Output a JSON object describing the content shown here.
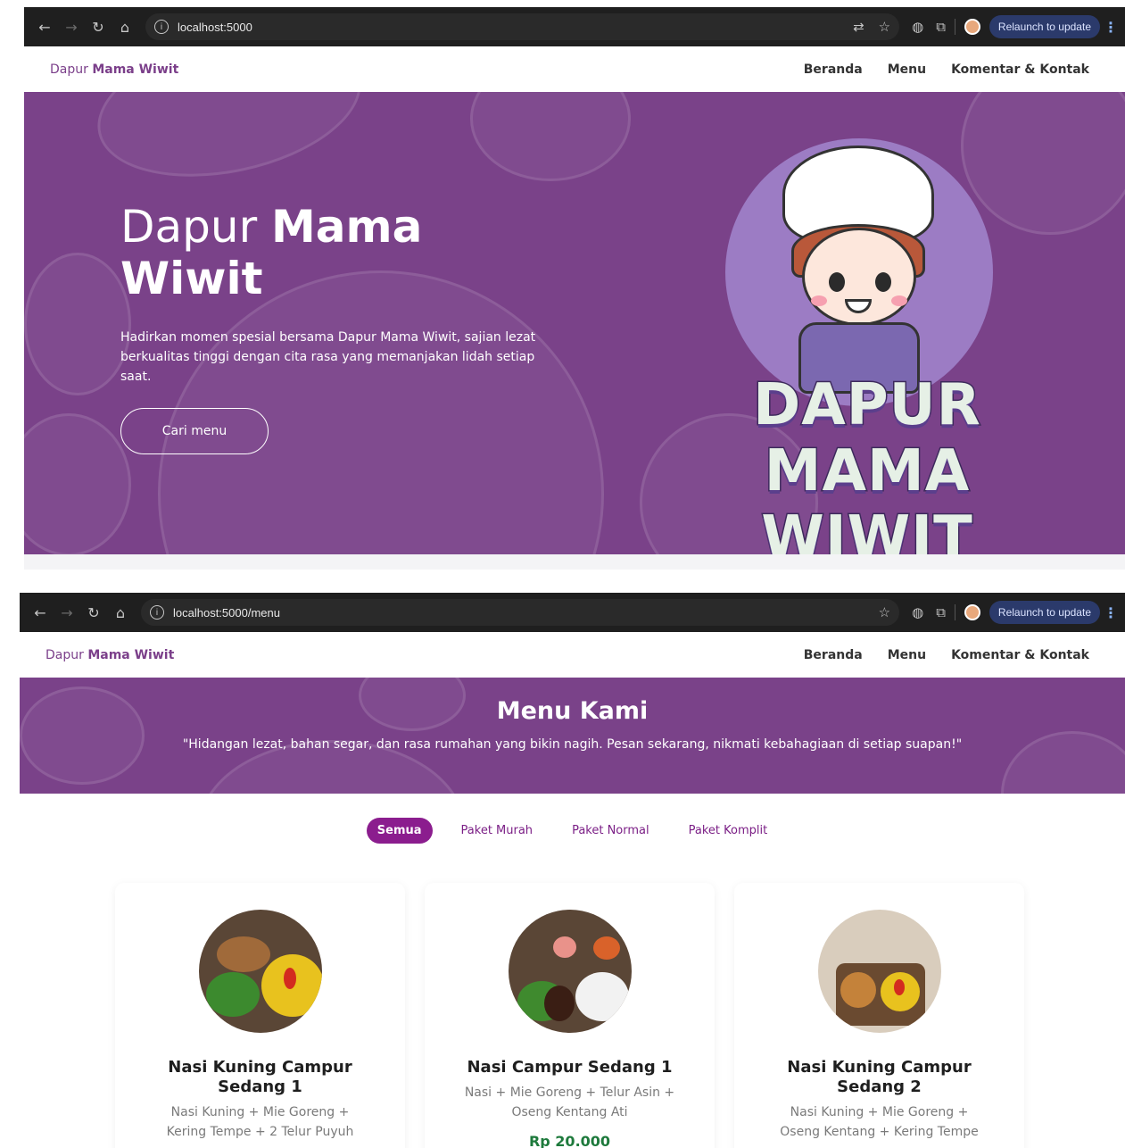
{
  "shot1": {
    "browser": {
      "url": "localhost:5000",
      "relaunch_label": "Relaunch to update"
    },
    "navbar": {
      "brand_prefix": "Dapur",
      "brand_bold": "Mama Wiwit",
      "links": [
        "Beranda",
        "Menu",
        "Komentar & Kontak"
      ]
    },
    "hero": {
      "title_regular": "Dapur",
      "title_bold_1": "Mama",
      "title_bold_2": "Wiwit",
      "description": "Hadirkan momen spesial bersama Dapur Mama Wiwit, sajian lezat berkualitas tinggi dengan cita rasa yang memanjakan lidah setiap saat.",
      "button_label": "Cari menu",
      "logo_line1": "DAPUR",
      "logo_line2": "MAMA WIWIT"
    }
  },
  "shot2": {
    "browser": {
      "url": "localhost:5000/menu",
      "relaunch_label": "Relaunch to update"
    },
    "navbar": {
      "brand_prefix": "Dapur",
      "brand_bold": "Mama Wiwit",
      "links": [
        "Beranda",
        "Menu",
        "Komentar & Kontak"
      ]
    },
    "menu_header": {
      "title": "Menu Kami",
      "quote": "\"Hidangan lezat, bahan segar, dan rasa rumahan yang bikin nagih. Pesan sekarang, nikmati kebahagiaan di setiap suapan!\""
    },
    "filters": [
      "Semua",
      "Paket Murah",
      "Paket Normal",
      "Paket Komplit"
    ],
    "active_filter": "Semua",
    "cards": [
      {
        "name": "Nasi Kuning Campur Sedang 1",
        "description": "Nasi Kuning + Mie Goreng + Kering Tempe + 2 Telur Puyuh",
        "price": ""
      },
      {
        "name": "Nasi Campur Sedang 1",
        "description": "Nasi + Mie Goreng + Telur Asin + Oseng Kentang Ati",
        "price": "Rp 20.000"
      },
      {
        "name": "Nasi Kuning Campur Sedang 2",
        "description": "Nasi Kuning + Mie Goreng + Oseng Kentang + Kering Tempe",
        "price": ""
      }
    ]
  },
  "colors": {
    "primary_purple": "#7a4289",
    "accent_magenta": "#8b1d8e",
    "price_green": "#1e7a3c"
  }
}
